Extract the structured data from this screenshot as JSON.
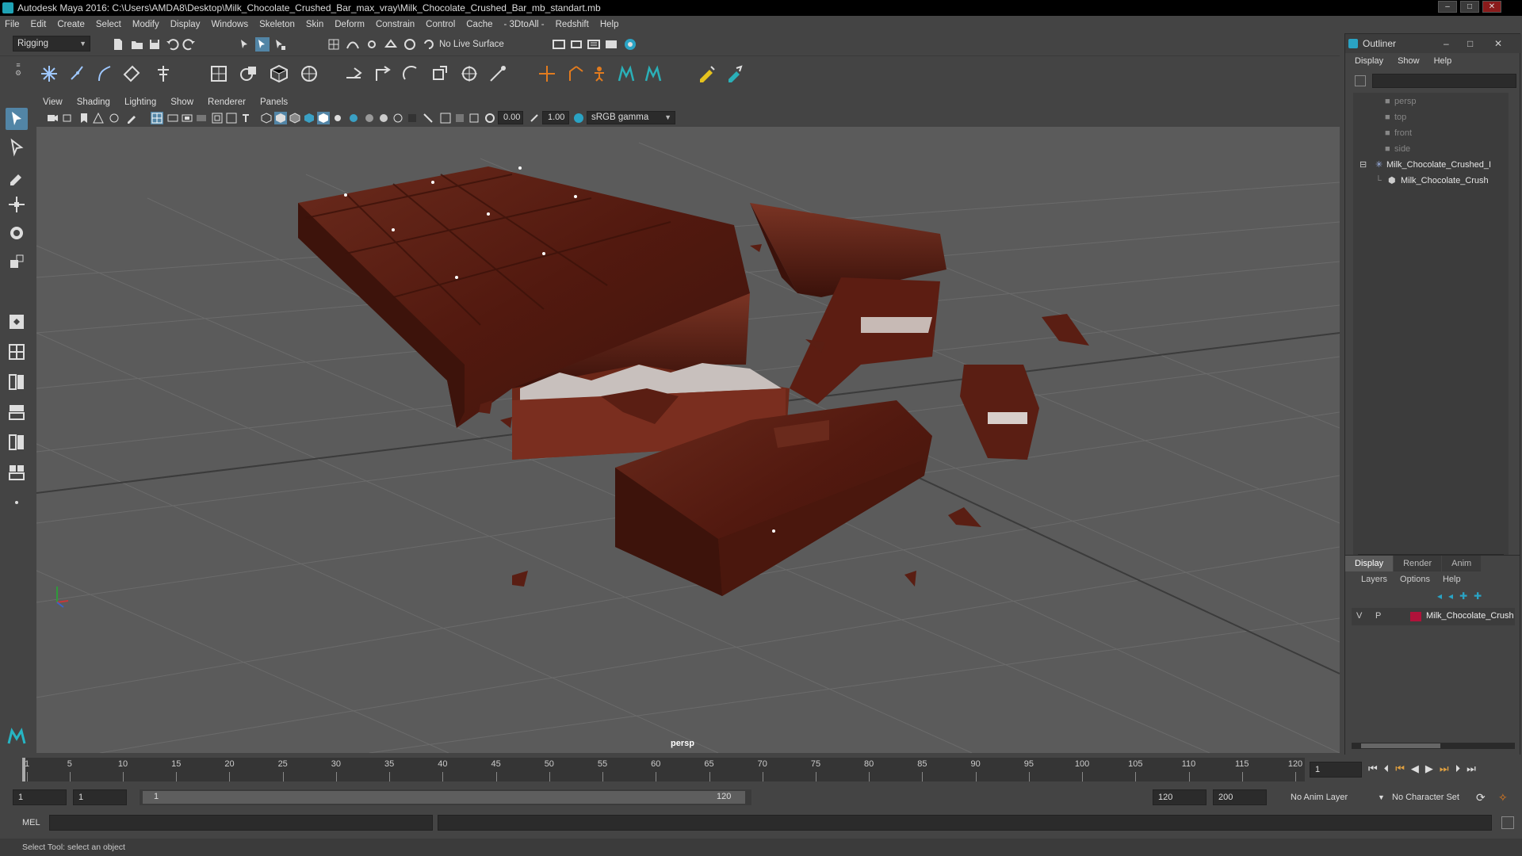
{
  "window": {
    "title": "Autodesk Maya 2016: C:\\Users\\AMDA8\\Desktop\\Milk_Chocolate_Crushed_Bar_max_vray\\Milk_Chocolate_Crushed_Bar_mb_standart.mb",
    "controls": [
      "–",
      "□",
      "✕"
    ]
  },
  "menubar": {
    "items": [
      "File",
      "Edit",
      "Create",
      "Select",
      "Modify",
      "Display",
      "Windows",
      "Skeleton",
      "Skin",
      "Deform",
      "Constrain",
      "Control",
      "Cache",
      "- 3DtoAll -",
      "Redshift",
      "Help"
    ]
  },
  "statusline": {
    "menuset": "Rigging",
    "live_surface": "No Live Surface"
  },
  "viewport": {
    "menu": [
      "View",
      "Shading",
      "Lighting",
      "Show",
      "Renderer",
      "Panels"
    ],
    "exposure": "0.00",
    "gamma": "1.00",
    "color_space": "sRGB gamma",
    "camera_label": "persp"
  },
  "outliner": {
    "title": "Outliner",
    "menu": [
      "Display",
      "Show",
      "Help"
    ],
    "items": [
      {
        "label": "persp"
      },
      {
        "label": "top"
      },
      {
        "label": "front"
      },
      {
        "label": "side"
      },
      {
        "label": "Milk_Chocolate_Crushed_I"
      },
      {
        "label": "Milk_Chocolate_Crush"
      }
    ]
  },
  "layer_editor": {
    "tabs": [
      "Display",
      "Render",
      "Anim"
    ],
    "menu": [
      "Layers",
      "Options",
      "Help"
    ],
    "layer": {
      "v": "V",
      "p": "P",
      "name": "Milk_Chocolate_Crush",
      "color": "#b0123a"
    }
  },
  "timeline": {
    "ticks": [
      "1",
      "5",
      "10",
      "15",
      "20",
      "25",
      "30",
      "35",
      "40",
      "45",
      "50",
      "55",
      "60",
      "65",
      "70",
      "75",
      "80",
      "85",
      "90",
      "95",
      "100",
      "105",
      "110",
      "115",
      "120"
    ],
    "current_frame": "1"
  },
  "range": {
    "start": "1",
    "playback_start": "1",
    "slider_start": "1",
    "slider_end": "120",
    "playback_end": "120",
    "end": "200",
    "anim_layer": "No Anim Layer",
    "character_set": "No Character Set"
  },
  "command": {
    "language": "MEL"
  },
  "helpline": {
    "text": "Select Tool: select an object"
  },
  "colors": {
    "ui_bg": "#444444",
    "viewport_bg": "#5b5b5b",
    "chocolate": "#5a1f14",
    "accent": "#1fa3b5"
  }
}
